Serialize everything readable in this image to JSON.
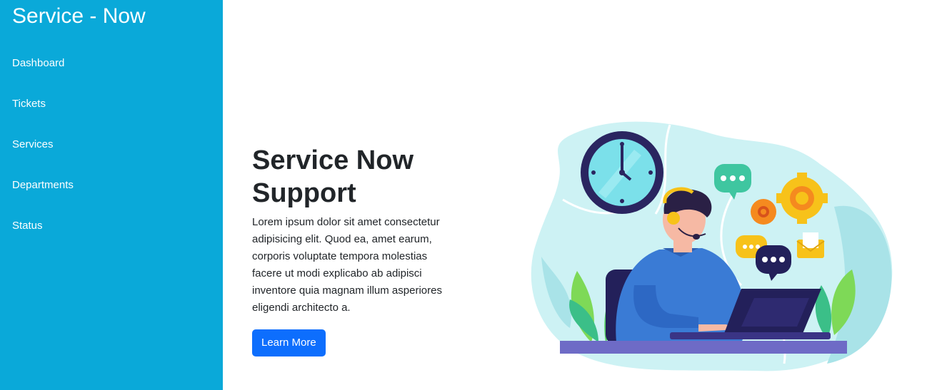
{
  "brand": {
    "title": "Service - Now"
  },
  "sidebar": {
    "items": [
      {
        "label": "Dashboard"
      },
      {
        "label": "Tickets"
      },
      {
        "label": "Services"
      },
      {
        "label": "Departments"
      },
      {
        "label": "Status"
      }
    ]
  },
  "hero": {
    "title_line1": "Service Now",
    "title_line2": "Support",
    "description": "Lorem ipsum dolor sit amet consectetur adipisicing elit. Quod ea, amet earum, corporis voluptate tempora molestias facere ut modi explicabo ab adipisci inventore quia magnam illum asperiores eligendi architecto a.",
    "button_label": "Learn More"
  },
  "colors": {
    "sidebar_bg": "#0aa9d9",
    "button_bg": "#0d6efd",
    "text_dark": "#212529",
    "illustration_blob": "#cdf2f4"
  },
  "illustration": {
    "icons": [
      "clock-icon",
      "chat-bubble-icon",
      "gear-icon",
      "envelope-icon",
      "laptop-icon",
      "headset-icon"
    ]
  }
}
